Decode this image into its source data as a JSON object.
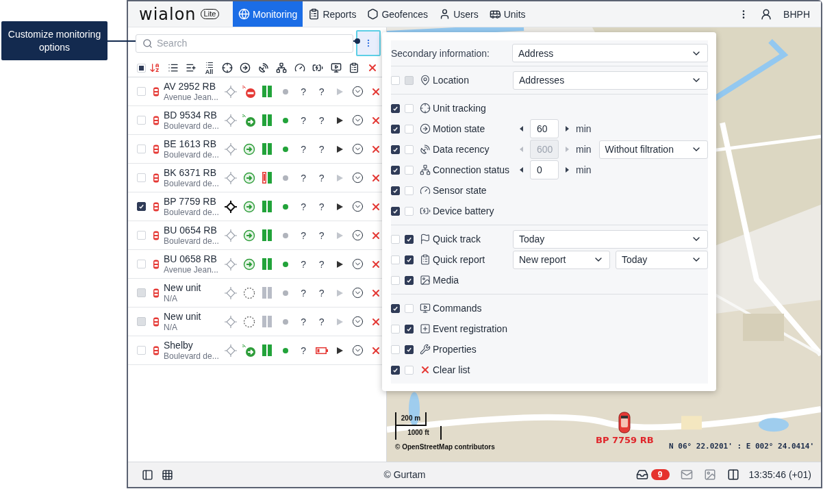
{
  "callout": {
    "text": "Customize monitoring options"
  },
  "logo": {
    "name": "wialon",
    "badge": "Lite"
  },
  "nav": [
    {
      "label": "Monitoring",
      "kind": "monitoring",
      "selected": true
    },
    {
      "label": "Reports",
      "kind": "reports",
      "selected": false
    },
    {
      "label": "Geofences",
      "kind": "geofences",
      "selected": false
    },
    {
      "label": "Users",
      "kind": "users",
      "selected": false
    },
    {
      "label": "Units",
      "kind": "units",
      "selected": false
    }
  ],
  "user": "BHPH",
  "search": {
    "placeholder": "Search"
  },
  "toolbar": {
    "select_all_partial": true,
    "all_label": "All"
  },
  "units": [
    {
      "name": "AV 2952 RB",
      "address": "Avenue Jean...",
      "checked": false,
      "disabled": false,
      "tracked": false,
      "has_data": true,
      "moving": false,
      "ignition": true,
      "data_fresh": true,
      "connected": false,
      "sensor": "?",
      "battery": "?",
      "battery_low": false,
      "command_active": false
    },
    {
      "name": "BD 9534 RB",
      "address": "Boulevard de...",
      "checked": false,
      "disabled": false,
      "tracked": false,
      "has_data": true,
      "moving": true,
      "ignition": true,
      "data_fresh": true,
      "connected": true,
      "sensor": "?",
      "battery": "?",
      "battery_low": false,
      "command_active": true
    },
    {
      "name": "BE 1613 RB",
      "address": "Boulevard de...",
      "checked": false,
      "disabled": false,
      "tracked": false,
      "has_data": true,
      "moving": true,
      "ignition": false,
      "data_fresh": true,
      "connected": true,
      "sensor": "?",
      "battery": "?",
      "battery_low": false,
      "command_active": true
    },
    {
      "name": "BK 6371 RB",
      "address": "Boulevard de...",
      "checked": false,
      "disabled": false,
      "tracked": false,
      "has_data": true,
      "moving": true,
      "ignition": false,
      "data_fresh": false,
      "connected": false,
      "sensor": "?",
      "battery": "?",
      "battery_low": false,
      "command_active": false
    },
    {
      "name": "BP 7759 RB",
      "address": "Boulevard de...",
      "checked": true,
      "disabled": false,
      "tracked": true,
      "has_data": true,
      "moving": true,
      "ignition": false,
      "data_fresh": true,
      "connected": true,
      "sensor": "?",
      "battery": "?",
      "battery_low": false,
      "command_active": true
    },
    {
      "name": "BU 0654 RB",
      "address": "Boulevard de...",
      "checked": false,
      "disabled": false,
      "tracked": false,
      "has_data": true,
      "moving": true,
      "ignition": false,
      "data_fresh": true,
      "connected": false,
      "sensor": "?",
      "battery": "?",
      "battery_low": false,
      "command_active": false
    },
    {
      "name": "BU 0658 RB",
      "address": "Avenue Jean...",
      "checked": false,
      "disabled": false,
      "tracked": false,
      "has_data": true,
      "moving": true,
      "ignition": false,
      "data_fresh": true,
      "connected": true,
      "sensor": "?",
      "battery": "?",
      "battery_low": false,
      "command_active": true
    },
    {
      "name": "New unit",
      "address": "N/A",
      "checked": false,
      "disabled": true,
      "tracked": false,
      "has_data": false,
      "connected": false,
      "sensor": "?",
      "battery": "?",
      "battery_low": false,
      "command_active": false
    },
    {
      "name": "New unit",
      "address": "N/A",
      "checked": false,
      "disabled": true,
      "tracked": false,
      "has_data": false,
      "connected": false,
      "sensor": "?",
      "battery": "?",
      "battery_low": false,
      "command_active": false
    },
    {
      "name": "Shelby",
      "address": "Boulevard de...",
      "checked": false,
      "disabled": false,
      "tracked": false,
      "has_data": true,
      "moving": true,
      "ignition": true,
      "data_fresh": true,
      "connected": true,
      "sensor": "?",
      "battery_low": true,
      "command_active": true
    }
  ],
  "options": {
    "secondary": {
      "label": "Secondary information:",
      "value": "Address"
    },
    "sections": [
      [
        {
          "kind": "select",
          "label": "Location",
          "in_list": false,
          "in_menu": false,
          "menu_disabled": true,
          "select": "Addresses"
        }
      ],
      [
        {
          "kind": "plain",
          "label": "Unit tracking",
          "in_list": true,
          "in_menu": false,
          "menu_disabled": false
        },
        {
          "kind": "number",
          "label": "Motion state",
          "in_list": true,
          "in_menu": false,
          "menu_disabled": false,
          "number": "60",
          "number_disabled": false,
          "unit": "min"
        },
        {
          "kind": "number_select",
          "label": "Data recency",
          "in_list": true,
          "in_menu": false,
          "menu_disabled": false,
          "number": "600",
          "number_disabled": true,
          "unit": "min",
          "select": "Without filtration"
        },
        {
          "kind": "number",
          "label": "Connection status",
          "in_list": true,
          "in_menu": false,
          "menu_disabled": false,
          "number": "0",
          "number_disabled": false,
          "unit": "min"
        },
        {
          "kind": "plain",
          "label": "Sensor state",
          "in_list": true,
          "in_menu": false,
          "menu_disabled": false
        },
        {
          "kind": "plain",
          "label": "Device battery",
          "in_list": true,
          "in_menu": false,
          "menu_disabled": false
        }
      ],
      [
        {
          "kind": "select",
          "label": "Quick track",
          "in_list": false,
          "in_menu": true,
          "menu_disabled": false,
          "select": "Today"
        },
        {
          "kind": "selects",
          "label": "Quick report",
          "in_list": false,
          "in_menu": true,
          "menu_disabled": false,
          "selects": [
            "New report",
            "Today"
          ]
        },
        {
          "kind": "plain",
          "label": "Media",
          "in_list": false,
          "in_menu": true,
          "menu_disabled": false
        }
      ],
      [
        {
          "kind": "plain",
          "label": "Commands",
          "in_list": true,
          "in_menu": false,
          "menu_disabled": false
        },
        {
          "kind": "plain",
          "label": "Event registration",
          "in_list": false,
          "in_menu": true,
          "menu_disabled": false
        },
        {
          "kind": "plain",
          "label": "Properties",
          "in_list": false,
          "in_menu": true,
          "menu_disabled": false
        },
        {
          "kind": "plain",
          "label": "Clear list",
          "in_list": true,
          "in_menu": false,
          "menu_disabled": false
        }
      ]
    ]
  },
  "map": {
    "scale": [
      "200 m",
      "1000 ft"
    ],
    "attribution": "© OpenStreetMap contributors",
    "marker_label": "BP 7759 RB",
    "coordinates": "N 06° 22.0201' : E 002° 24.0414'"
  },
  "footer": {
    "copyright": "© Gurtam",
    "notifications": "9",
    "time": "13:35:46 (+01)"
  }
}
